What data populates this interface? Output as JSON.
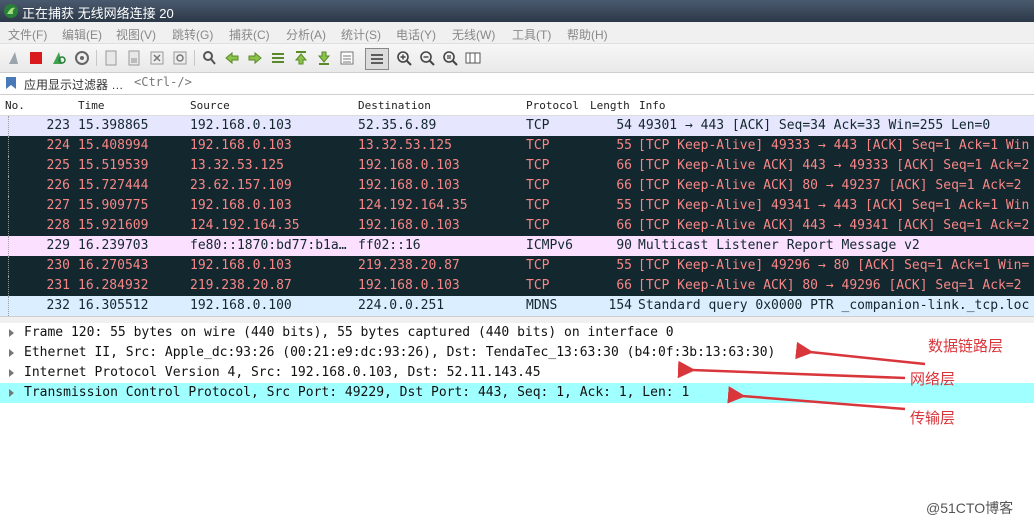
{
  "window": {
    "title": "正在捕获 无线网络连接 20"
  },
  "menu": [
    "文件(F)",
    "编辑(E)",
    "视图(V)",
    "跳转(G)",
    "捕获(C)",
    "分析(A)",
    "统计(S)",
    "电话(Y)",
    "无线(W)",
    "工具(T)",
    "帮助(H)"
  ],
  "toolbar": {
    "icons": [
      "shark-fin-icon",
      "stop-icon",
      "restart-icon",
      "options-gear-icon",
      "open-file-icon",
      "save-file-icon",
      "close-file-icon",
      "reload-icon",
      "find-packet-icon",
      "go-back-icon",
      "go-forward-icon",
      "go-to-packet-icon",
      "go-first-icon",
      "go-last-icon",
      "autoscroll-icon",
      "colorize-icon",
      "zoom-in-icon",
      "zoom-out-icon",
      "zoom-normal-icon",
      "resize-columns-icon"
    ]
  },
  "filter": {
    "label": "应用显示过滤器 …",
    "hint": "<Ctrl-/>"
  },
  "columns": {
    "no": "No.",
    "time": "Time",
    "source": "Source",
    "destination": "Destination",
    "protocol": "Protocol",
    "length": "Length",
    "info": "Info"
  },
  "packets": [
    {
      "no": "223",
      "time": "15.398865",
      "source": "192.168.0.103",
      "destination": "52.35.6.89",
      "protocol": "TCP",
      "length": "54",
      "info": "49301 → 443 [ACK] Seq=34 Ack=33 Win=255 Len=0",
      "style": "r-tcp-light"
    },
    {
      "no": "224",
      "time": "15.408994",
      "source": "192.168.0.103",
      "destination": "13.32.53.125",
      "protocol": "TCP",
      "length": "55",
      "info": "[TCP Keep-Alive] 49333 → 443 [ACK] Seq=1 Ack=1 Win",
      "style": "r-dark"
    },
    {
      "no": "225",
      "time": "15.519539",
      "source": "13.32.53.125",
      "destination": "192.168.0.103",
      "protocol": "TCP",
      "length": "66",
      "info": "[TCP Keep-Alive ACK] 443 → 49333 [ACK] Seq=1 Ack=2",
      "style": "r-dark"
    },
    {
      "no": "226",
      "time": "15.727444",
      "source": "23.62.157.109",
      "destination": "192.168.0.103",
      "protocol": "TCP",
      "length": "66",
      "info": "[TCP Keep-Alive ACK] 80 → 49237 [ACK] Seq=1 Ack=2",
      "style": "r-dark"
    },
    {
      "no": "227",
      "time": "15.909775",
      "source": "192.168.0.103",
      "destination": "124.192.164.35",
      "protocol": "TCP",
      "length": "55",
      "info": "[TCP Keep-Alive] 49341 → 443 [ACK] Seq=1 Ack=1 Win",
      "style": "r-dark"
    },
    {
      "no": "228",
      "time": "15.921609",
      "source": "124.192.164.35",
      "destination": "192.168.0.103",
      "protocol": "TCP",
      "length": "66",
      "info": "[TCP Keep-Alive ACK] 443 → 49341 [ACK] Seq=1 Ack=2",
      "style": "r-dark"
    },
    {
      "no": "229",
      "time": "16.239703",
      "source": "fe80::1870:bd77:b1a…",
      "destination": "ff02::16",
      "protocol": "ICMPv6",
      "length": "90",
      "info": "Multicast Listener Report Message v2",
      "style": "r-icmp"
    },
    {
      "no": "230",
      "time": "16.270543",
      "source": "192.168.0.103",
      "destination": "219.238.20.87",
      "protocol": "TCP",
      "length": "55",
      "info": "[TCP Keep-Alive] 49296 → 80 [ACK] Seq=1 Ack=1 Win=",
      "style": "r-dark"
    },
    {
      "no": "231",
      "time": "16.284932",
      "source": "219.238.20.87",
      "destination": "192.168.0.103",
      "protocol": "TCP",
      "length": "66",
      "info": "[TCP Keep-Alive ACK] 80 → 49296 [ACK] Seq=1 Ack=2",
      "style": "r-dark"
    },
    {
      "no": "232",
      "time": "16.305512",
      "source": "192.168.0.100",
      "destination": "224.0.0.251",
      "protocol": "MDNS",
      "length": "154",
      "info": "Standard query 0x0000 PTR _companion-link._tcp.loc",
      "style": "r-udp"
    }
  ],
  "details": [
    {
      "text": "Frame 120: 55 bytes on wire (440 bits), 55 bytes captured (440 bits) on interface 0",
      "selected": false
    },
    {
      "text": "Ethernet II, Src: Apple_dc:93:26 (00:21:e9:dc:93:26), Dst: TendaTec_13:63:30 (b4:0f:3b:13:63:30)",
      "selected": false
    },
    {
      "text": "Internet Protocol Version 4, Src: 192.168.0.103, Dst: 52.11.143.45",
      "selected": false
    },
    {
      "text": "Transmission Control Protocol, Src Port: 49229, Dst Port: 443, Seq: 1, Ack: 1, Len: 1",
      "selected": true
    }
  ],
  "annotations": {
    "datalink": "数据链路层",
    "network": "网络层",
    "transport": "传输层",
    "color": "#d8363b"
  },
  "watermark": "@51CTO博客"
}
